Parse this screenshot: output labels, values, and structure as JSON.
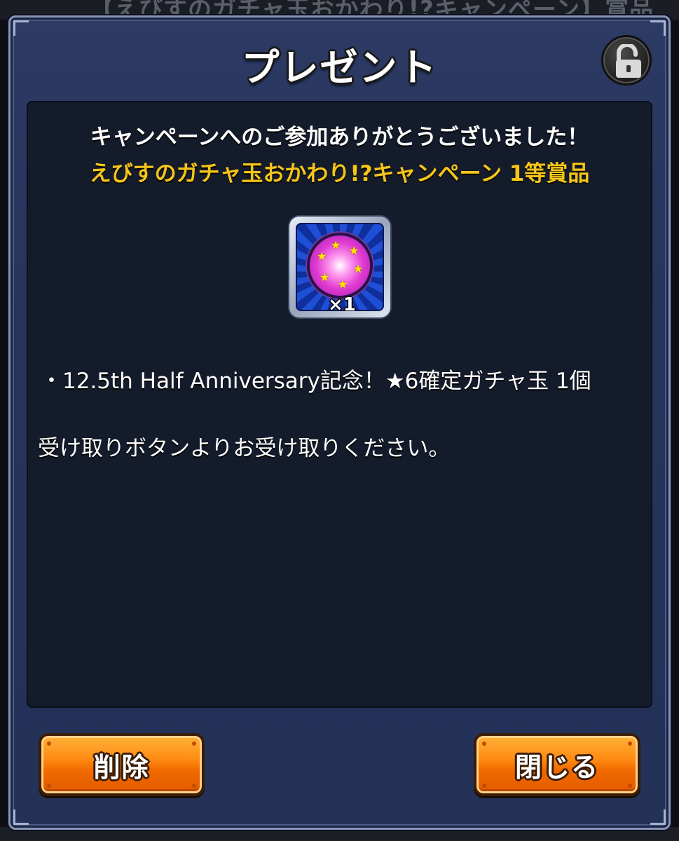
{
  "background": {
    "header_text": "【えびすのガチャ玉おかわり!?キャンペーン】賞品"
  },
  "dialog": {
    "title": "プレゼント",
    "lock_icon": "unlocked-padlock-icon",
    "message_line1": "キャンペーンへのご参加ありがとうございました！",
    "message_line2": "えびすのガチャ玉おかわり!?キャンペーン 1等賞品",
    "item": {
      "icon": "gacha-orb-icon",
      "quantity": "×1"
    },
    "item_description": "・12.5th Half Anniversary記念！★6確定ガチャ玉 1個",
    "instruction": "受け取りボタンよりお受け取りください。"
  },
  "buttons": {
    "delete_label": "削除",
    "close_label": "閉じる"
  },
  "colors": {
    "accent_yellow": "#f5c518",
    "button_orange": "#ff8c14",
    "dialog_blue": "#2c3a64",
    "panel_dark": "#141b2a"
  }
}
